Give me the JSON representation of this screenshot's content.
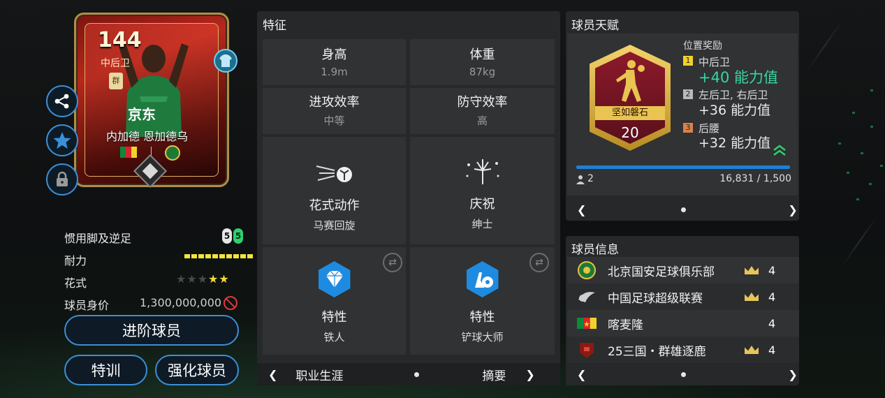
{
  "player_card": {
    "rating": "144",
    "position": "中后卫",
    "club_text": "京东",
    "name": "内加德 恩加德乌",
    "card_badge_text": "群"
  },
  "side_buttons": [
    "share-icon",
    "star-icon",
    "lock-icon"
  ],
  "stats": {
    "weak_foot_label": "惯用脚及逆足",
    "weak_foot_left": "5",
    "weak_foot_right": "5",
    "stamina_label": "耐力",
    "stamina_segments": 10,
    "skill_label": "花式",
    "skill_stars": "★★",
    "skill_stars_empty": "★★★",
    "value_label": "球员身价",
    "value": "1,300,000,000"
  },
  "buttons": {
    "upgrade": "进阶球员",
    "training": "特训",
    "enhance": "强化球员"
  },
  "traits": {
    "title": "特征",
    "height_label": "身高",
    "height": "1.9m",
    "weight_label": "体重",
    "weight": "87kg",
    "attack_label": "进攻效率",
    "attack": "中等",
    "defense_label": "防守效率",
    "defense": "高",
    "skill_move_label": "花式动作",
    "skill_move": "马赛回旋",
    "celebration_label": "庆祝",
    "celebration": "绅士",
    "trait1_label": "特性",
    "trait1": "铁人",
    "trait2_label": "特性",
    "trait2": "铲球大师",
    "nav_left": "职业生涯",
    "nav_right": "摘要"
  },
  "talent": {
    "title": "球员天赋",
    "badge_name": "坚如磐石",
    "badge_level": "20",
    "bonus_title": "位置奖励",
    "bonus1_rank": "1",
    "bonus1_pos": "中后卫",
    "bonus1_value": "+40 能力值",
    "bonus2_rank": "2",
    "bonus2_pos": "左后卫, 右后卫",
    "bonus2_value": "+36 能力值",
    "bonus3_rank": "3",
    "bonus3_pos": "后腰",
    "bonus3_value": "+32 能力值",
    "level_count": "2",
    "progress": "16,831 / 1,500",
    "progress_fraction": 1.0
  },
  "info": {
    "title": "球员信息",
    "rows": [
      {
        "text": "北京国安足球俱乐部",
        "chem": "4"
      },
      {
        "text": "中国足球超级联赛",
        "chem": "4"
      },
      {
        "text": "喀麦隆",
        "chem": "4"
      },
      {
        "text": "25三国・群雄逐鹿",
        "chem": "4"
      }
    ]
  },
  "colors": {
    "accent_blue": "#3b8fd8",
    "green_value": "#39d6a0",
    "stamina_yellow": "#f3e53a",
    "star_yellow": "#f2dc35"
  }
}
